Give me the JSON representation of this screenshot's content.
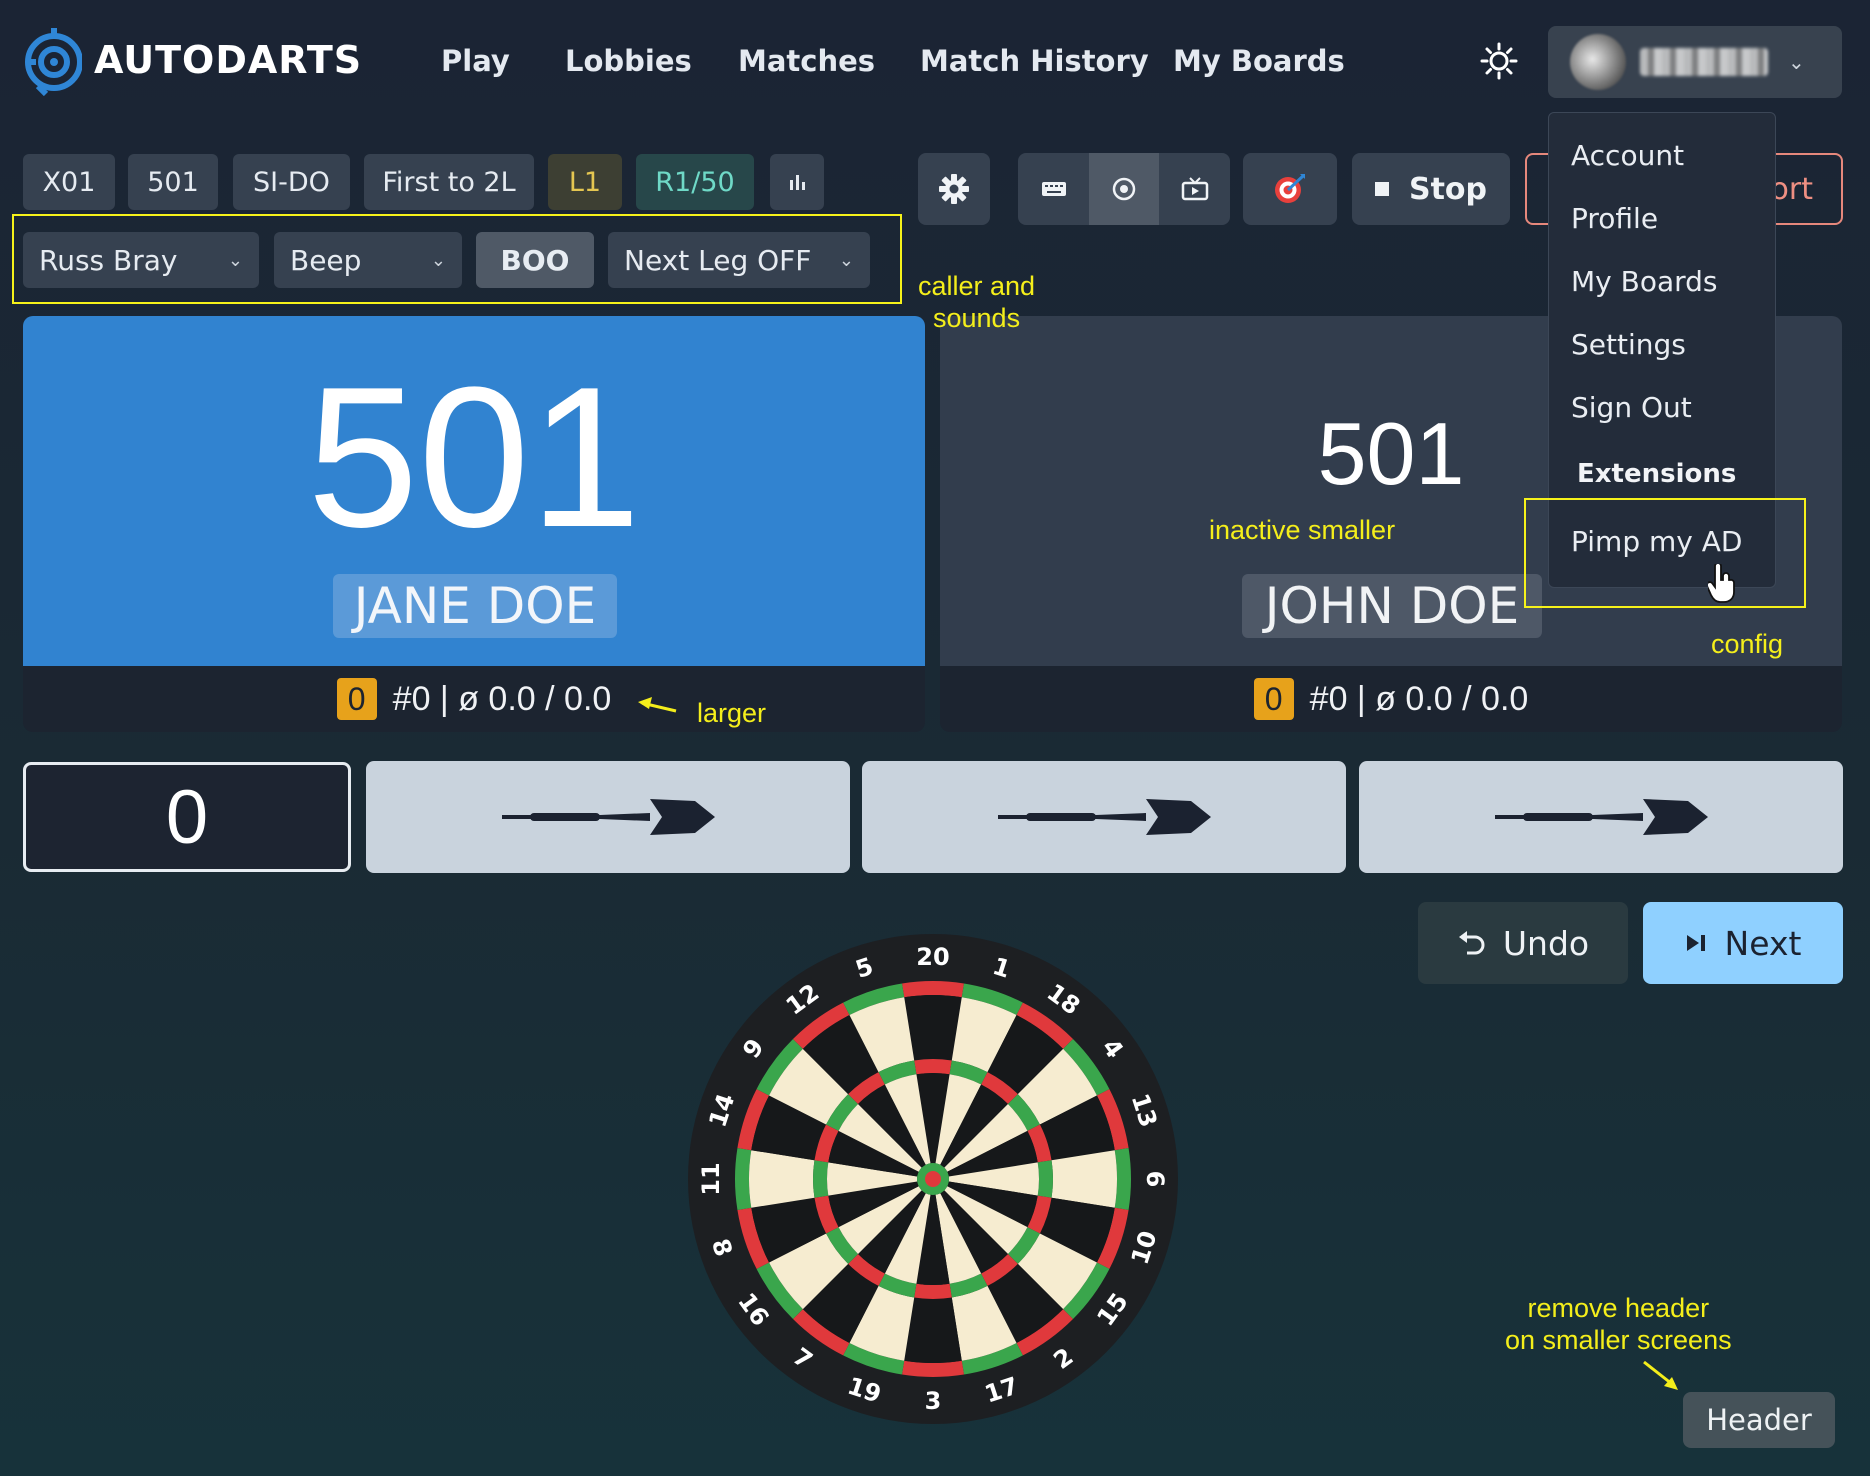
{
  "brand": {
    "name": "AUTODARTS",
    "accent": "#2f86d6"
  },
  "nav": {
    "items": [
      "Play",
      "Lobbies",
      "Matches",
      "Match History",
      "My Boards"
    ]
  },
  "user_menu": {
    "items": [
      "Account",
      "Profile",
      "My Boards",
      "Settings",
      "Sign Out"
    ],
    "extensions_heading": "Extensions",
    "extension_item": "Pimp my AD"
  },
  "toolbar": {
    "chips": [
      "X01",
      "501",
      "SI-DO",
      "First to 2L",
      "L1",
      "R1/50"
    ],
    "stop_label": "Stop",
    "export_label": "ort"
  },
  "caller": {
    "caller_value": "Russ Bray",
    "sound_value": "Beep",
    "boo_label": "BOO",
    "next_leg_value": "Next Leg OFF"
  },
  "players": [
    {
      "score": "501",
      "name": "JANE DOE",
      "badge": "0",
      "stats": "#0 | ø 0.0 / 0.0",
      "active": true
    },
    {
      "score": "501",
      "name": "JOHN DOE",
      "badge": "0",
      "stats": "#0 | ø 0.0 / 0.0",
      "active": false
    }
  ],
  "turn": {
    "points": "0",
    "darts_remaining": 3
  },
  "actions": {
    "undo_label": "Undo",
    "next_label": "Next",
    "header_label": "Header"
  },
  "board": {
    "numbers_clockwise": [
      "20",
      "1",
      "18",
      "4",
      "13",
      "6",
      "10",
      "15",
      "2",
      "17",
      "3",
      "19",
      "7",
      "16",
      "8",
      "11",
      "14",
      "9",
      "12",
      "5"
    ]
  },
  "annotations": {
    "caller": "caller and\nsounds",
    "inactive": "inactive smaller",
    "config": "config",
    "larger": "larger",
    "remove_header": "remove header\non smaller screens"
  },
  "colors": {
    "active_card": "#3183d0",
    "next_button": "#8fd0ff",
    "annotation": "#f4ee1b",
    "badge": "#e7a21b"
  }
}
